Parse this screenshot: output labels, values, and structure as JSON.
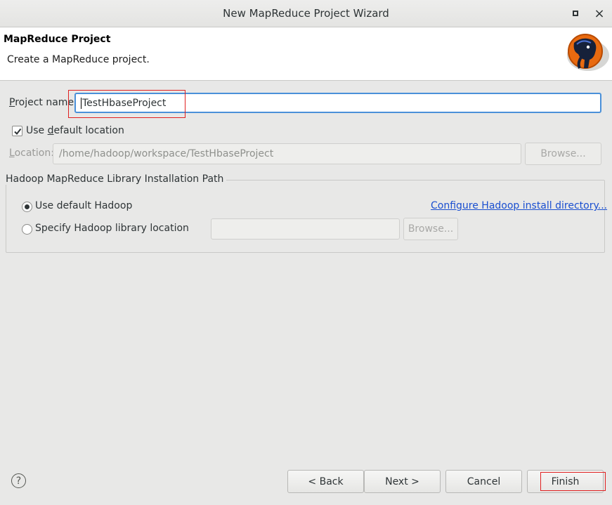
{
  "window": {
    "title": "New MapReduce Project Wizard",
    "minimize_glyph": "",
    "close_glyph": "×"
  },
  "header": {
    "title": "MapReduce Project",
    "description": "Create a MapReduce project.",
    "logo_icon": "hadoop-elephant-logo"
  },
  "project": {
    "name_label_mnemonic": "P",
    "name_label_rest": "roject name:",
    "name_value": "TestHbaseProject"
  },
  "location": {
    "use_default_label_prefix": "Use ",
    "use_default_label_mnemonic": "d",
    "use_default_label_rest": "efault location",
    "use_default_checked": true,
    "label_mnemonic": "L",
    "label_rest": "ocation:",
    "path": "/home/hadoop/workspace/TestHbaseProject",
    "browse_label": "Browse..."
  },
  "hadoop_group": {
    "title": "Hadoop MapReduce Library Installation Path",
    "use_default_label": "Use default Hadoop",
    "use_default_selected": true,
    "configure_link": "Configure Hadoop install directory...",
    "specify_label": "Specify Hadoop library location",
    "specify_value": "",
    "browse_label": "Browse..."
  },
  "footer": {
    "help_glyph": "?",
    "back_label": "< Back",
    "next_label": "Next >",
    "cancel_label": "Cancel",
    "finish_label": "Finish"
  },
  "colors": {
    "background": "#e8e8e7",
    "link": "#1a4fd0",
    "focus": "#4a90d9",
    "annotation": "#e02020"
  }
}
